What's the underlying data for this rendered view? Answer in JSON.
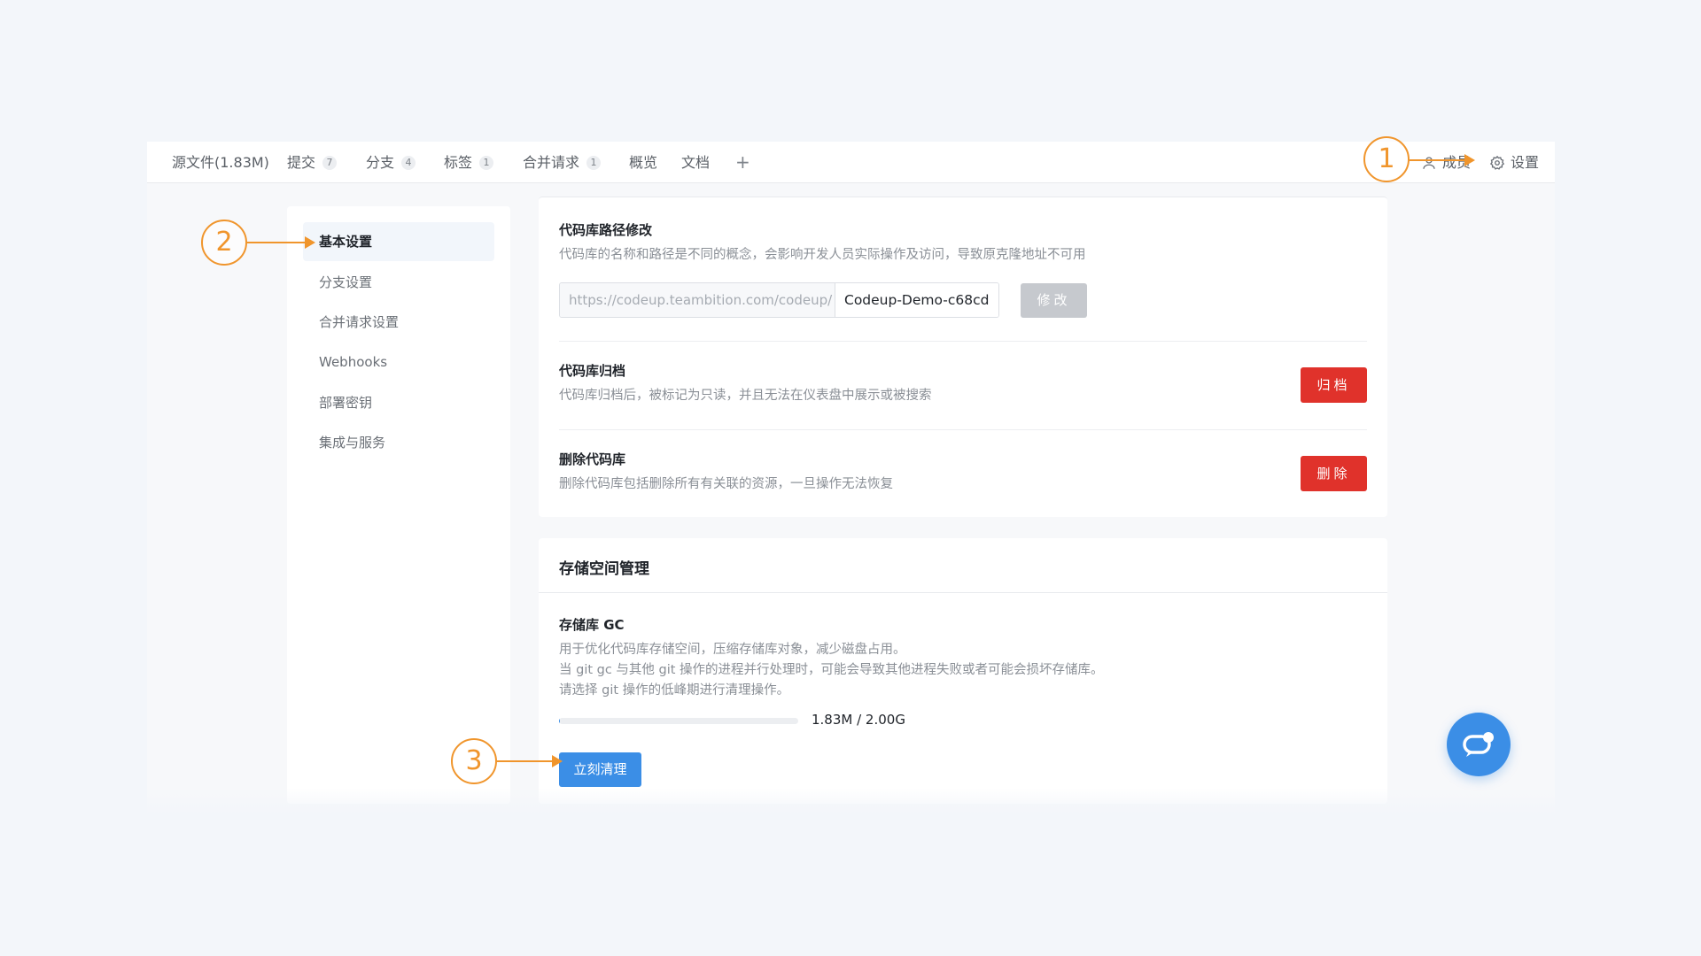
{
  "nav": {
    "tabs": [
      {
        "label": "源文件(1.83M)",
        "badge": ""
      },
      {
        "label": "提交",
        "badge": "7"
      },
      {
        "label": "分支",
        "badge": "4"
      },
      {
        "label": "标签",
        "badge": "1"
      },
      {
        "label": "合并请求",
        "badge": "1"
      },
      {
        "label": "概览",
        "badge": ""
      },
      {
        "label": "文档",
        "badge": ""
      }
    ],
    "add_label": "+",
    "members_label": "成员",
    "settings_label": "设置"
  },
  "sidebar": {
    "items": [
      {
        "label": "基本设置",
        "active": true
      },
      {
        "label": "分支设置"
      },
      {
        "label": "合并请求设置"
      },
      {
        "label": "Webhooks"
      },
      {
        "label": "部署密钥"
      },
      {
        "label": "集成与服务"
      }
    ]
  },
  "path_section": {
    "title": "代码库路径修改",
    "desc": "代码库的名称和路径是不同的概念，会影响开发人员实际操作及访问，导致原克隆地址不可用",
    "prefix": "https://codeup.teambition.com/codeup/",
    "value": "Codeup-Demo-c68cd",
    "button": "修改"
  },
  "archive_section": {
    "title": "代码库归档",
    "desc": "代码库归档后，被标记为只读，并且无法在仪表盘中展示或被搜索",
    "button": "归档"
  },
  "delete_section": {
    "title": "删除代码库",
    "desc": "删除代码库包括删除所有有关联的资源，一旦操作无法恢复",
    "button": "删除"
  },
  "storage": {
    "title": "存储空间管理",
    "gc_title": "存储库 GC",
    "desc_lines": [
      "用于优化代码库存储空间，压缩存储库对象，减少磁盘占用。",
      "当 git gc 与其他 git 操作的进程并行处理时，可能会导致其他进程失败或者可能会损坏存储库。",
      "请选择 git 操作的低峰期进行清理操作。"
    ],
    "usage_fraction": 0.0009,
    "usage_label": "1.83M / 2.00G",
    "button": "立刻清理"
  },
  "callouts": [
    "1",
    "2",
    "3"
  ],
  "colors": {
    "primary": "#3b8ee6",
    "danger": "#e0322b",
    "callout": "#f0952c"
  }
}
